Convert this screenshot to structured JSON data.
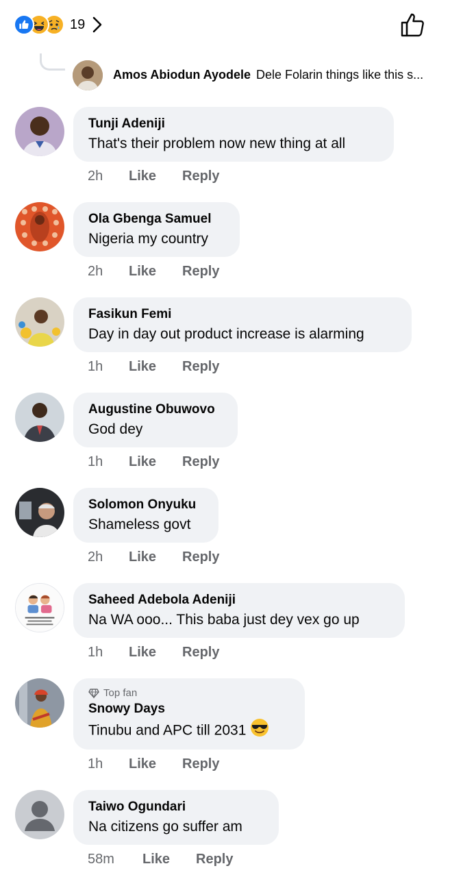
{
  "reactions": {
    "count": "19",
    "icons": [
      "like-icon",
      "haha-icon",
      "sad-icon"
    ]
  },
  "reply_preview": {
    "name": "Amos Abiodun Ayodele",
    "text": "Dele Folarin things like this s..."
  },
  "actions": {
    "like": "Like",
    "reply": "Reply"
  },
  "comments": [
    {
      "name": "Tunji Adeniji",
      "text": "That's their problem now new thing at all",
      "time": "2h"
    },
    {
      "name": "Ola Gbenga Samuel",
      "text": "Nigeria my country",
      "time": "2h"
    },
    {
      "name": "Fasikun Femi",
      "text": "Day in day out product increase is alarming",
      "time": "1h"
    },
    {
      "name": "Augustine Obuwovo",
      "text": "God dey",
      "time": "1h"
    },
    {
      "name": "Solomon Onyuku",
      "text": "Shameless govt",
      "time": "2h"
    },
    {
      "name": "Saheed Adebola Adeniji",
      "text": "Na WA ooo... This baba just dey vex go up",
      "time": "1h"
    },
    {
      "name": "Snowy Days",
      "badge": "Top fan",
      "text": "Tinubu and APC till 2031",
      "emoji": "sunglasses-face-icon",
      "time": "1h"
    },
    {
      "name": "Taiwo Ogundari",
      "text": "Na citizens go suffer am",
      "time": "58m"
    }
  ],
  "colors": {
    "like_blue": "#1877f2",
    "bubble": "#f0f2f5",
    "meta_gray": "#65676b"
  }
}
